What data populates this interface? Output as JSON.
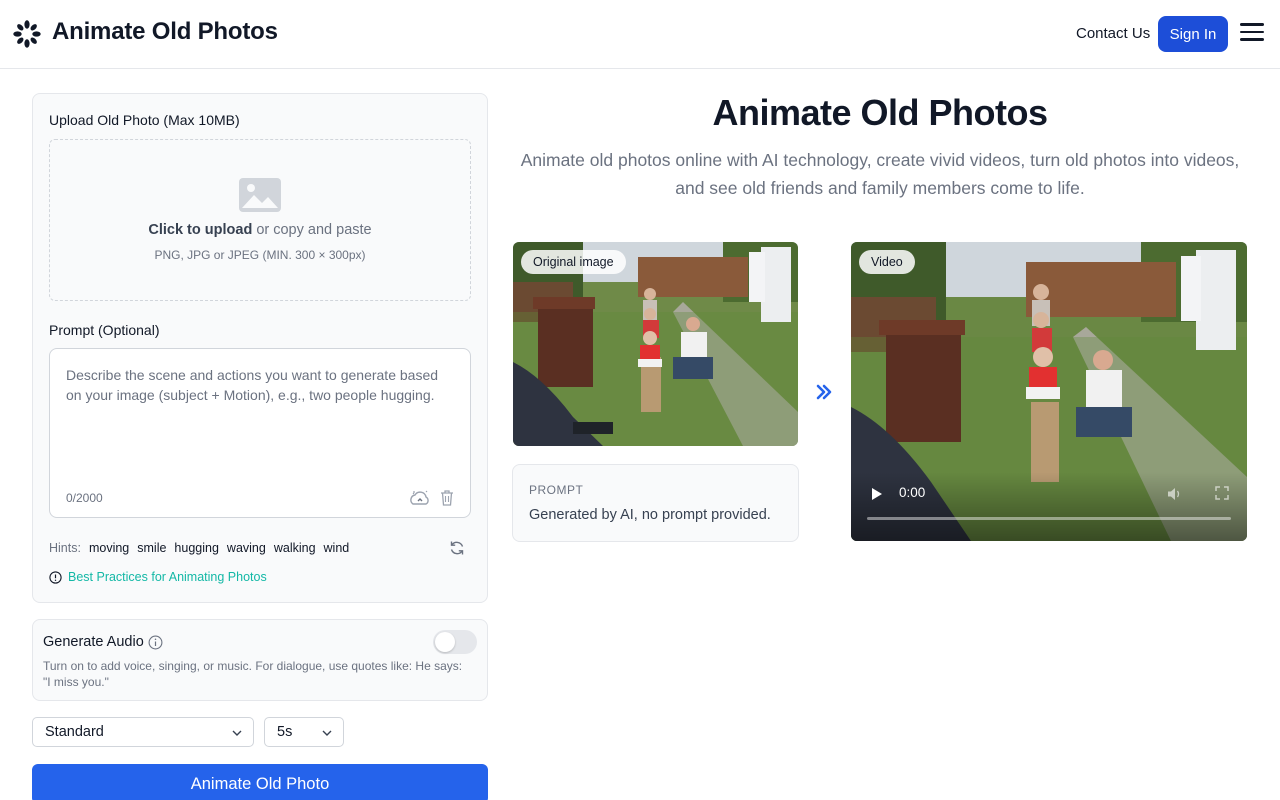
{
  "header": {
    "brand": "Animate Old Photos",
    "contact": "Contact Us",
    "sign_in": "Sign In"
  },
  "upload": {
    "label": "Upload Old Photo (Max 10MB)",
    "click_strong": "Click to upload",
    "click_rest": " or copy and paste",
    "types": "PNG, JPG or JPEG (MIN. 300 × 300px)"
  },
  "prompt": {
    "label": "Prompt (Optional)",
    "placeholder": "Describe the scene and actions you want to generate based on your image (subject + Motion), e.g., two people hugging.",
    "counter": "0/2000"
  },
  "hints": {
    "label": "Hints:",
    "items": [
      "moving",
      "smile",
      "hugging",
      "waving",
      "walking",
      "wind"
    ]
  },
  "best_practices": "Best Practices for Animating Photos",
  "audio": {
    "title": "Generate Audio",
    "description": "Turn on to add voice, singing, or music. For dialogue, use quotes like: He says: \"I miss you.\"",
    "enabled": false
  },
  "options": {
    "quality": "Standard",
    "duration": "5s"
  },
  "animate_button": "Animate Old Photo",
  "hero": {
    "title": "Animate Old Photos",
    "subtitle": "Animate old photos online with AI technology, create vivid videos, turn old photos into videos, and see old friends and family members come to life."
  },
  "example": {
    "original_badge": "Original image",
    "video_badge": "Video",
    "prompt_heading": "PROMPT",
    "prompt_text": "Generated by AI, no prompt provided.",
    "video_time": "0:00"
  },
  "colors": {
    "primary": "#2563eb",
    "sign_in": "#1d4ed8",
    "link": "#14b8a6"
  }
}
